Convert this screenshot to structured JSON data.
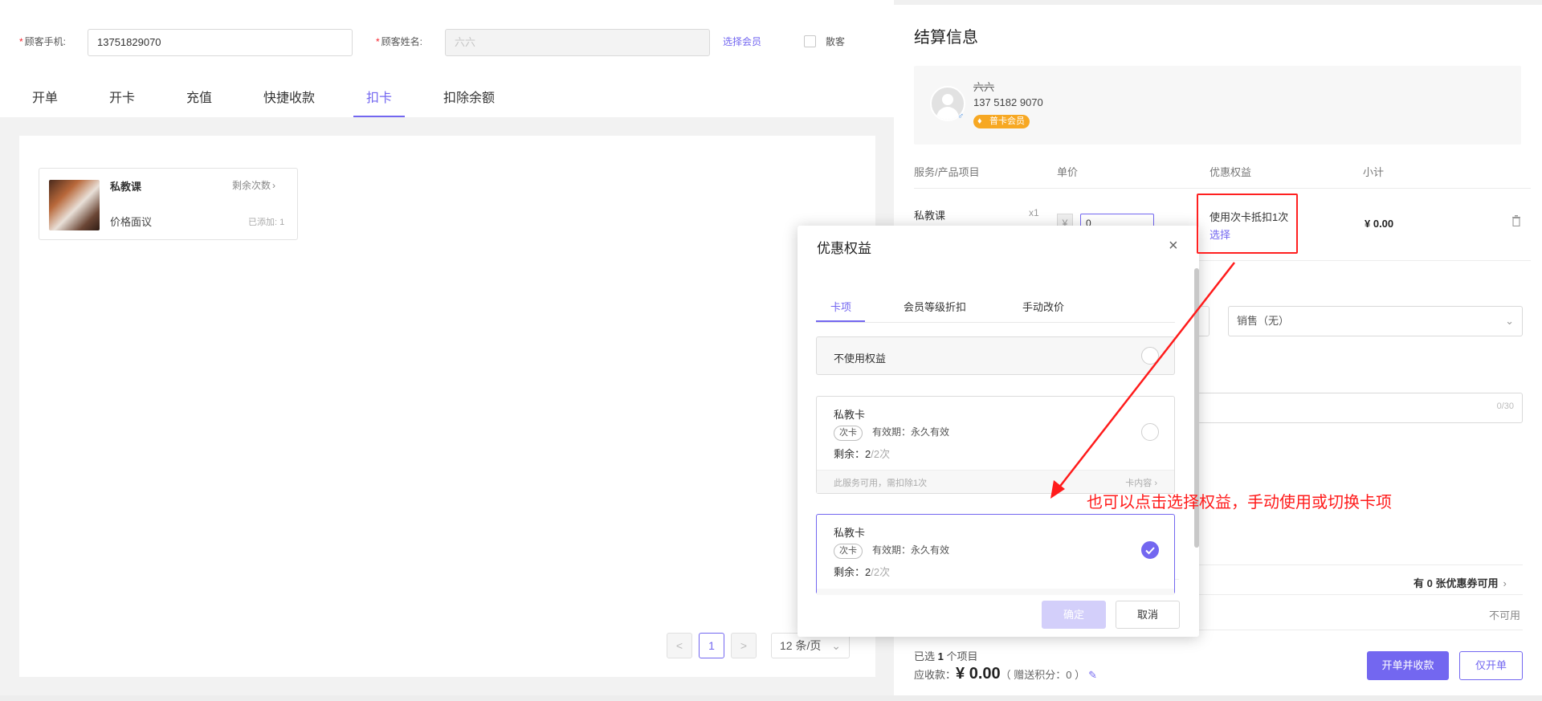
{
  "customer_form": {
    "phone_label": "顾客手机:",
    "phone_value": "13751829070",
    "name_label": "顾客姓名:",
    "name_value": "六六",
    "select_member": "选择会员",
    "walkin_label": "散客"
  },
  "tabs": [
    "开单",
    "开卡",
    "充值",
    "快捷收款",
    "扣卡",
    "扣除余额"
  ],
  "active_tab": "扣卡",
  "product_card": {
    "name": "私教课",
    "remaining_label": "剩余次数",
    "price": "价格面议",
    "added": "已添加: 1"
  },
  "pagination": {
    "prev": "<",
    "page": "1",
    "next": ">",
    "page_size": "12 条/页"
  },
  "settlement": {
    "title": "结算信息",
    "customer_name": "六六",
    "customer_phone": "137 5182 9070",
    "member_level": "普卡会员",
    "columns": [
      "服务/产品项目",
      "单价",
      "优惠权益",
      "小计"
    ],
    "row": {
      "item": "私教课",
      "qty": "x1",
      "price_prefix": "¥",
      "price_value": "0",
      "benefit": "使用次卡抵扣1次",
      "benefit_select": "选择",
      "subtotal": "¥ 0.00"
    },
    "seller_placeholder": "销售（无）",
    "note_counter": "0/30",
    "coupon_text": "有 0 张优惠券可用",
    "unavailable": "不可用",
    "selected_text_prefix": "已选",
    "selected_count": "1",
    "selected_text_suffix": "个项目",
    "receivable_label": "应收款：",
    "receivable_amount": "¥ 0.00",
    "points_text": "（ 赠送积分：0 ）",
    "checkout_button": "开单并收款",
    "open_only_button": "仅开单"
  },
  "modal": {
    "title": "优惠权益",
    "close": "×",
    "tabs": [
      "卡项",
      "会员等级折扣",
      "手动改价"
    ],
    "active_tab": "卡项",
    "no_benefit": "不使用权益",
    "options": [
      {
        "name": "私教卡",
        "tag": "次卡",
        "validity": "有效期：永久有效",
        "remaining_label": "剩余：",
        "remaining_value": "2",
        "remaining_total": "/2次",
        "footer_left": "此服务可用，需扣除1次",
        "footer_right": "卡内容",
        "selected": false
      },
      {
        "name": "私教卡",
        "tag": "次卡",
        "validity": "有效期：永久有效",
        "remaining_label": "剩余：",
        "remaining_value": "2",
        "remaining_total": "/2次",
        "selected": true
      }
    ],
    "confirm": "确定",
    "cancel": "取消"
  },
  "annotation": "也可以点击选择权益，手动使用或切换卡项",
  "colors": {
    "accent": "#7367f0",
    "annotation": "#ff1b1b",
    "vip": "#f7a823"
  }
}
